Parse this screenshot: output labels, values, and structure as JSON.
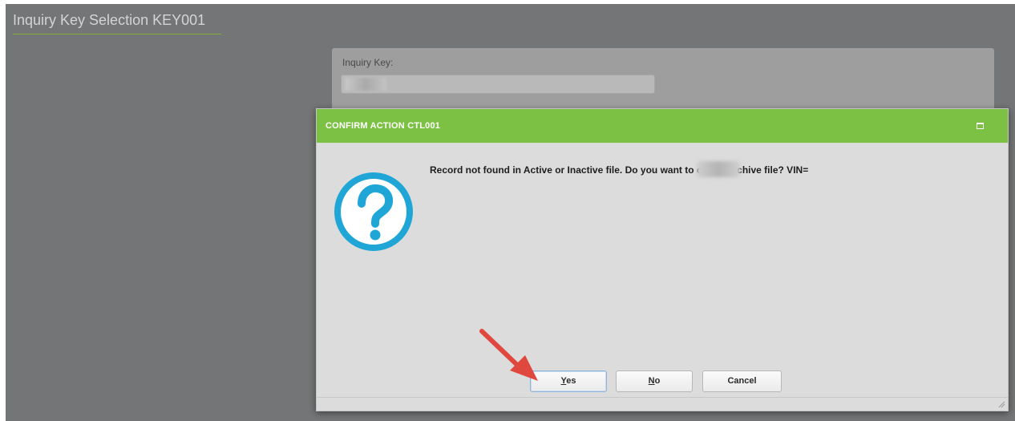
{
  "page": {
    "title": "Inquiry Key Selection KEY001"
  },
  "inquiry": {
    "label": "Inquiry Key:",
    "value": ""
  },
  "dialog": {
    "title": "CONFIRM ACTION CTL001",
    "icon": "question-circle-icon",
    "message": "Record not found in Active or Inactive file. Do you want to check Archive file? VIN=",
    "buttons": {
      "yes_mnemonic": "Y",
      "yes_rest": "es",
      "no_mnemonic": "N",
      "no_rest": "o",
      "cancel": "Cancel"
    }
  },
  "annotation": {
    "arrow_color": "#e0483f"
  },
  "colors": {
    "header_green": "#7cc143",
    "icon_blue": "#1fa6d7",
    "overlay_gray": "#737576"
  }
}
